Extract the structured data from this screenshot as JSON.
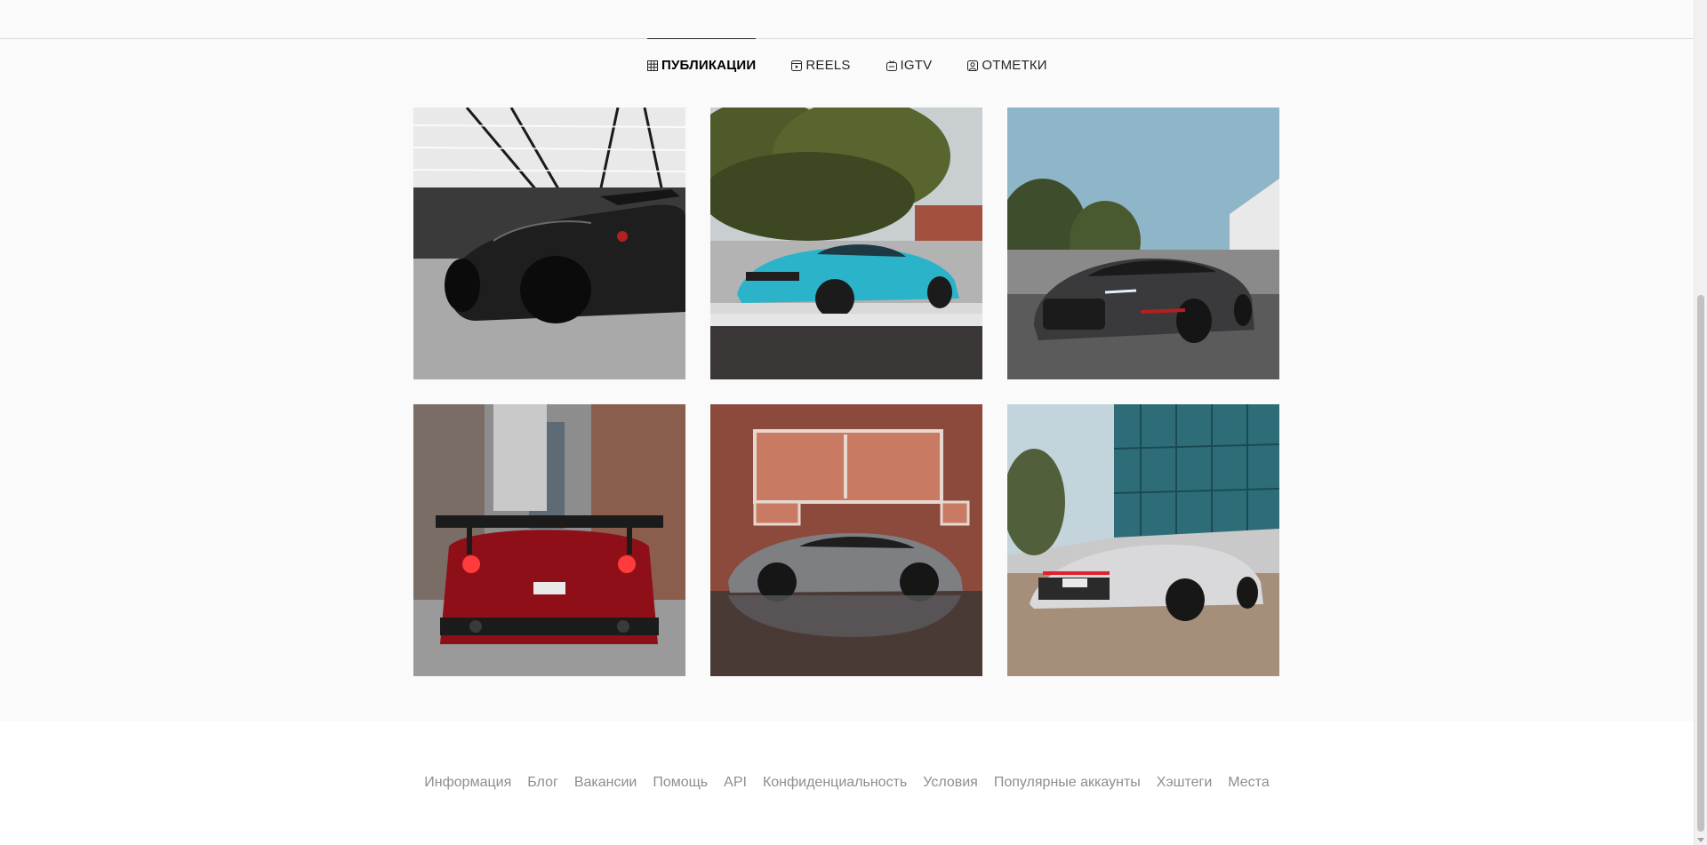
{
  "tabs": [
    {
      "label": "ПУБЛИКАЦИИ",
      "icon": "grid-icon",
      "active": true
    },
    {
      "label": "REELS",
      "icon": "reels-icon",
      "active": false
    },
    {
      "label": "IGTV",
      "icon": "igtv-icon",
      "active": false
    },
    {
      "label": "ОТМЕТКИ",
      "icon": "tagged-icon",
      "active": false
    }
  ],
  "posts": [
    {
      "subject": "black widebody sports car in garage"
    },
    {
      "subject": "turquoise Audi R8 on street"
    },
    {
      "subject": "grey Audi R8 front view"
    },
    {
      "subject": "red Nissan GT-R rear view"
    },
    {
      "subject": "grey Audi R8 by brick wall"
    },
    {
      "subject": "silver Audi R8 by glass building"
    }
  ],
  "footer": {
    "links": [
      "Информация",
      "Блог",
      "Вакансии",
      "Помощь",
      "API",
      "Конфиденциальность",
      "Условия",
      "Популярные аккаунты",
      "Хэштеги",
      "Места"
    ]
  },
  "colors": {
    "background": "#fafafa",
    "divider": "#dbdbdb",
    "footer_link": "#8e8e8e",
    "active_tab": "#000000"
  }
}
